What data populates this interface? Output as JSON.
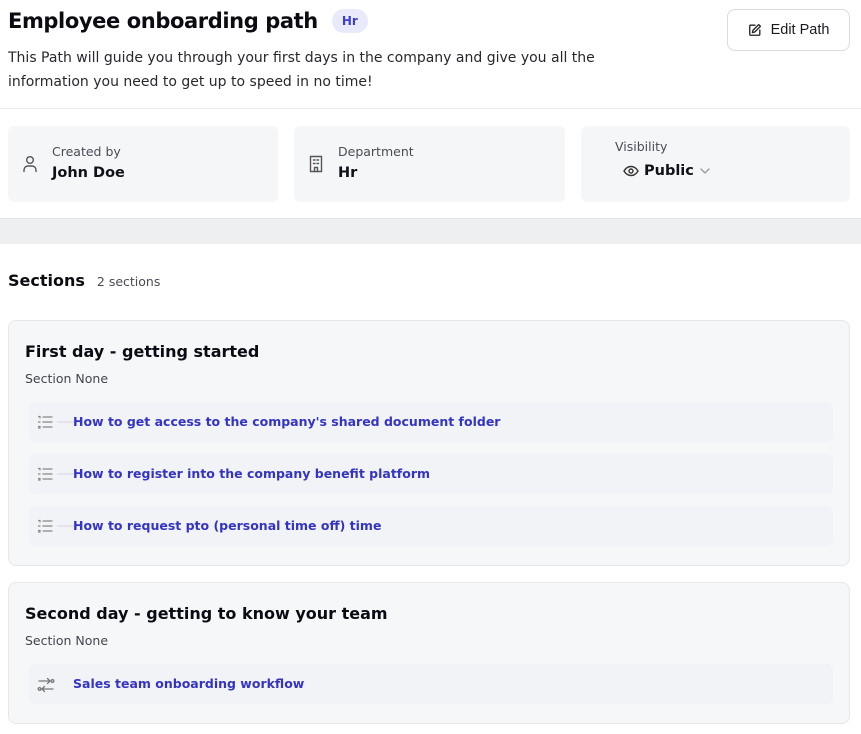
{
  "header": {
    "title": "Employee onboarding path",
    "tag": "Hr",
    "description": "This Path will guide you through your first days in the company and give you all the information you need to get up to speed in no time!",
    "edit_label": "Edit Path"
  },
  "info": {
    "created_by": {
      "label": "Created by",
      "value": "John Doe",
      "icon": "user-icon"
    },
    "department": {
      "label": "Department",
      "value": "Hr",
      "icon": "building-icon"
    },
    "visibility": {
      "label": "Visibility",
      "value": "Public",
      "icon": "eye-icon"
    }
  },
  "sections_header": {
    "title": "Sections",
    "count": "2 sections"
  },
  "sections": [
    {
      "title": "First day - getting started",
      "subtitle": "Section None",
      "items": [
        {
          "label": "How to get access to the company's shared document folder",
          "icon": "list-icon"
        },
        {
          "label": "How to register into the company benefit platform",
          "icon": "list-icon"
        },
        {
          "label": "How to request pto (personal time off) time",
          "icon": "list-icon"
        }
      ]
    },
    {
      "title": "Second day - getting to know your team",
      "subtitle": "Section None",
      "items": [
        {
          "label": "Sales team onboarding workflow",
          "icon": "workflow-icon"
        }
      ]
    }
  ],
  "colors": {
    "link": "#3434c4",
    "tag_bg": "#e8eafb",
    "tag_text": "#3b3fc9",
    "card_bg": "#f5f6f8"
  }
}
